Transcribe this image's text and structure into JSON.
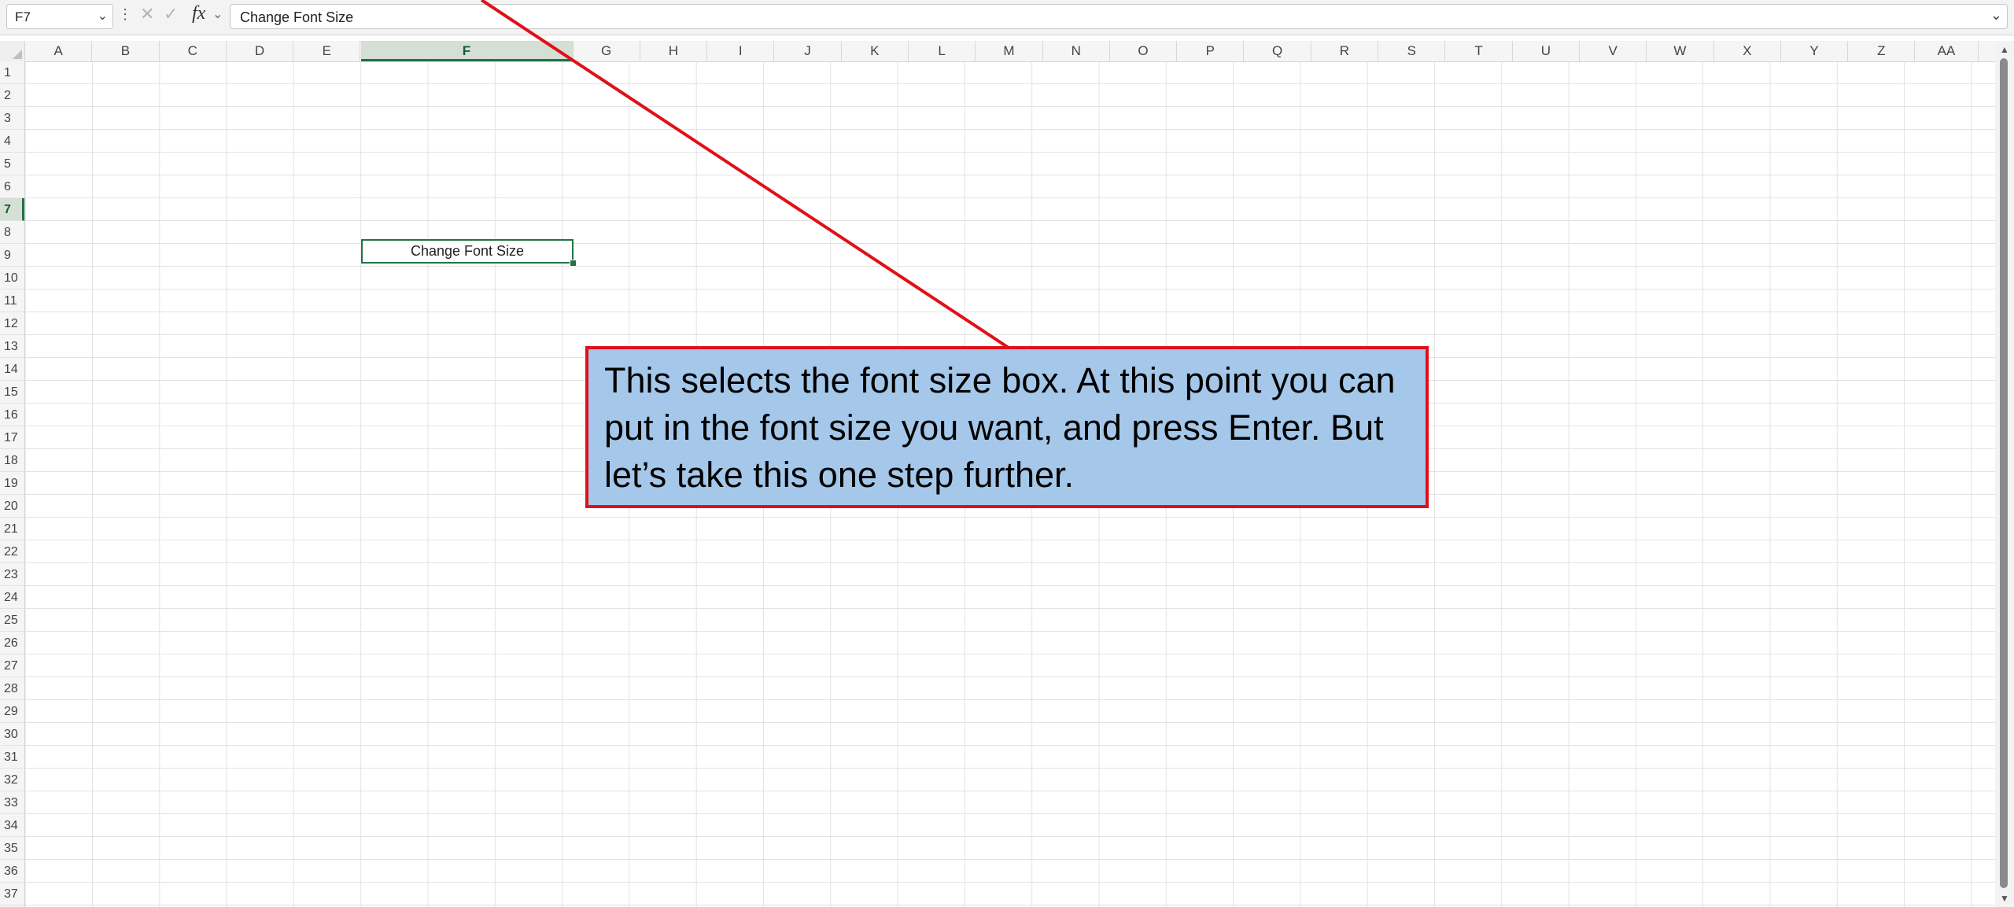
{
  "formula_bar": {
    "name_box": "F7",
    "dots_icon": "⋮",
    "cancel_icon": "✕",
    "enter_icon": "✓",
    "fx_label": "fx",
    "content": "Change Font Size"
  },
  "columns": [
    "A",
    "B",
    "C",
    "D",
    "E",
    "F",
    "G",
    "H",
    "I",
    "J",
    "K",
    "L",
    "M",
    "N",
    "O",
    "P",
    "Q",
    "R",
    "S",
    "T",
    "U",
    "V",
    "W",
    "X",
    "Y",
    "Z",
    "AA"
  ],
  "rows": [
    "1",
    "2",
    "3",
    "4",
    "5",
    "6",
    "7",
    "8",
    "9",
    "10",
    "11",
    "12",
    "13",
    "14",
    "15",
    "16",
    "17",
    "18",
    "19",
    "20",
    "21",
    "22",
    "23",
    "24",
    "25",
    "26",
    "27",
    "28",
    "29",
    "30",
    "31",
    "32",
    "33",
    "34",
    "35",
    "36",
    "37"
  ],
  "selected_column": "F",
  "selected_row": "7",
  "active_cell": {
    "ref": "F7",
    "value": "Change Font Size"
  },
  "callout": {
    "text": "This selects the font size box. At this point you can put in the font size you want, and press Enter. But let’s take this one step further.",
    "background": "#a5c8ea",
    "border_color": "#e0101a"
  },
  "accent_color": "#217346"
}
